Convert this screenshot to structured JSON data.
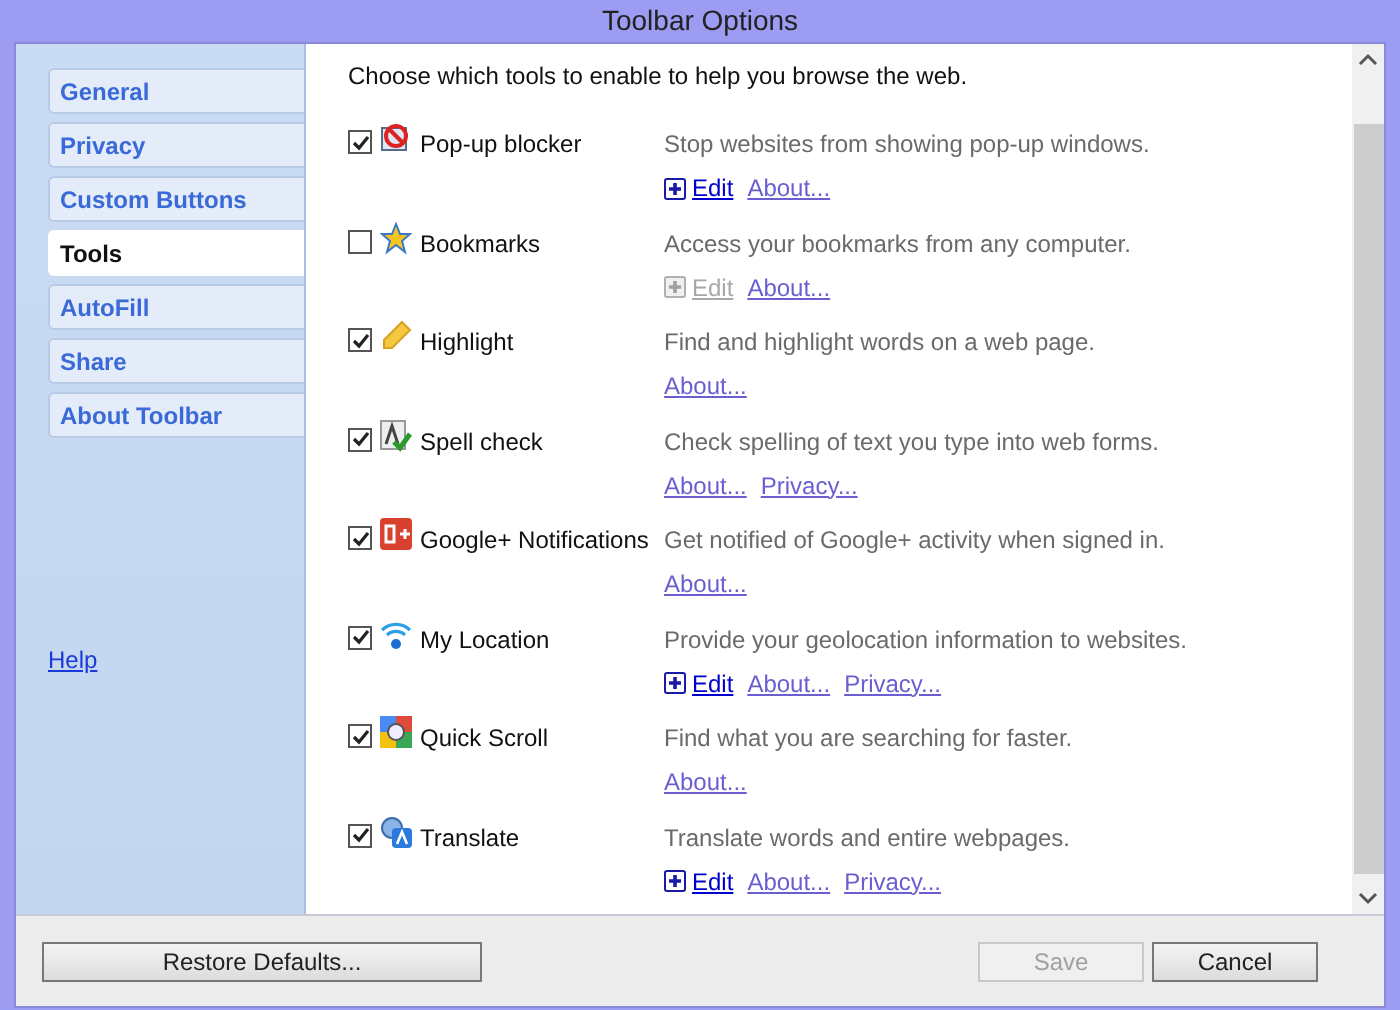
{
  "window": {
    "title": "Toolbar Options"
  },
  "sidebar": {
    "items": [
      {
        "label": "General",
        "selected": false
      },
      {
        "label": "Privacy",
        "selected": false
      },
      {
        "label": "Custom Buttons",
        "selected": false
      },
      {
        "label": "Tools",
        "selected": true
      },
      {
        "label": "AutoFill",
        "selected": false
      },
      {
        "label": "Share",
        "selected": false
      },
      {
        "label": "About Toolbar",
        "selected": false
      }
    ],
    "help_link": "Help"
  },
  "intro": "Choose which tools to enable to help you browse the web.",
  "tools": [
    {
      "name": "Pop-up blocker",
      "checked": true,
      "description": "Stop websites from showing pop-up windows.",
      "links": [
        {
          "kind": "edit",
          "label": "Edit",
          "disabled": false
        },
        {
          "kind": "about",
          "label": "About..."
        }
      ]
    },
    {
      "name": "Bookmarks",
      "checked": false,
      "description": "Access your bookmarks from any computer.",
      "links": [
        {
          "kind": "edit",
          "label": "Edit",
          "disabled": true
        },
        {
          "kind": "about",
          "label": "About..."
        }
      ]
    },
    {
      "name": "Highlight",
      "checked": true,
      "description": "Find and highlight words on a web page.",
      "links": [
        {
          "kind": "about",
          "label": "About..."
        }
      ]
    },
    {
      "name": "Spell check",
      "checked": true,
      "description": "Check spelling of text you type into web forms.",
      "links": [
        {
          "kind": "about",
          "label": "About..."
        },
        {
          "kind": "privacy",
          "label": "Privacy..."
        }
      ]
    },
    {
      "name": "Google+ Notifications",
      "checked": true,
      "description": "Get notified of Google+ activity when signed in.",
      "links": [
        {
          "kind": "about",
          "label": "About..."
        }
      ]
    },
    {
      "name": "My Location",
      "checked": true,
      "description": "Provide your geolocation information to websites.",
      "links": [
        {
          "kind": "edit",
          "label": "Edit",
          "disabled": false
        },
        {
          "kind": "about",
          "label": "About..."
        },
        {
          "kind": "privacy",
          "label": "Privacy..."
        }
      ]
    },
    {
      "name": "Quick Scroll",
      "checked": true,
      "description": "Find what you are searching for faster.",
      "links": [
        {
          "kind": "about",
          "label": "About..."
        }
      ]
    },
    {
      "name": "Translate",
      "checked": true,
      "description": "Translate words and entire webpages.",
      "links": [
        {
          "kind": "edit",
          "label": "Edit",
          "disabled": false
        },
        {
          "kind": "about",
          "label": "About..."
        },
        {
          "kind": "privacy",
          "label": "Privacy..."
        }
      ]
    }
  ],
  "footer": {
    "restore_button": "Restore Defaults...",
    "save_button": {
      "label": "Save",
      "disabled": true
    },
    "cancel_button": "Cancel"
  }
}
